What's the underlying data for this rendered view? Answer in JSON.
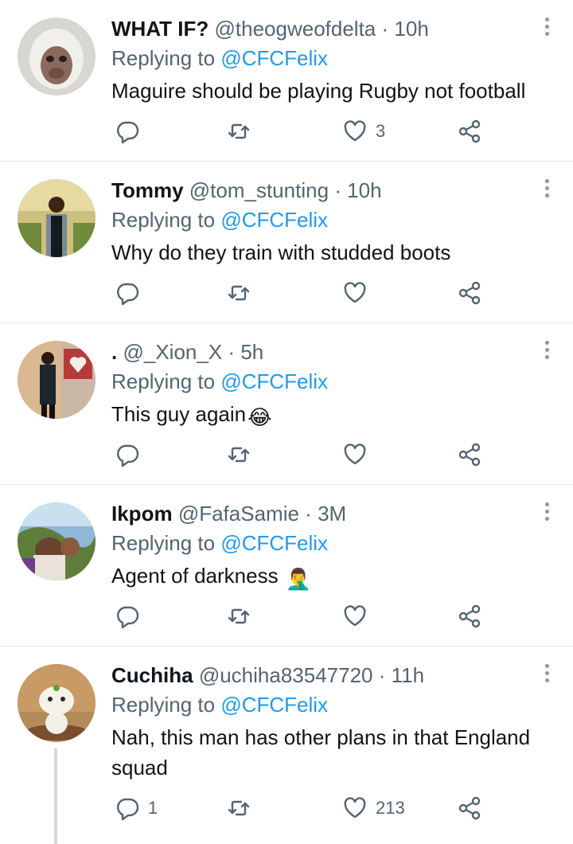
{
  "tweets": [
    {
      "name": "WHAT IF?",
      "handle": "@theogweofdelta",
      "dot": "·",
      "time": "10h",
      "reply_label": "Replying to",
      "reply_user": "@CFCFelix",
      "text": "Maguire should be playing Rugby not football",
      "reply_count": "",
      "retweet_count": "",
      "like_count": "3",
      "avatar": "white-monkey-avatar"
    },
    {
      "name": "Tommy",
      "handle": "@tom_stunting",
      "dot": "·",
      "time": "10h",
      "reply_label": "Replying to",
      "reply_user": "@CFCFelix",
      "text": "Why do they train with studded boots",
      "reply_count": "",
      "retweet_count": "",
      "like_count": "",
      "avatar": "man-standing-avatar"
    },
    {
      "name": ".",
      "handle": "@_Xion_X",
      "dot": "·",
      "time": "5h",
      "reply_label": "Replying to",
      "reply_user": "@CFCFelix",
      "text": "This guy again",
      "emoji": "😂",
      "reply_count": "",
      "retweet_count": "",
      "like_count": "",
      "avatar": "man-heart-wall-avatar"
    },
    {
      "name": "Ikpom",
      "handle": "@FafaSamie",
      "dot": "·",
      "time": "3M",
      "reply_label": "Replying to",
      "reply_user": "@CFCFelix",
      "text": "Agent of darkness ",
      "emoji": "🤦‍♂️",
      "reply_count": "",
      "retweet_count": "",
      "like_count": "",
      "avatar": "selfie-avatar"
    },
    {
      "name": "Cuchiha",
      "handle": "@uchiha83547720",
      "dot": "·",
      "time": "11h",
      "reply_label": "Replying to",
      "reply_user": "@CFCFelix",
      "text": "Nah, this man has other plans in that England squad",
      "reply_count": "1",
      "retweet_count": "",
      "like_count": "213",
      "avatar": "kodama-figure-avatar"
    }
  ],
  "colors": {
    "link": "#1d9bf0",
    "secondary": "#536471",
    "primary": "#0f1419",
    "divider": "#e6e9ec"
  }
}
